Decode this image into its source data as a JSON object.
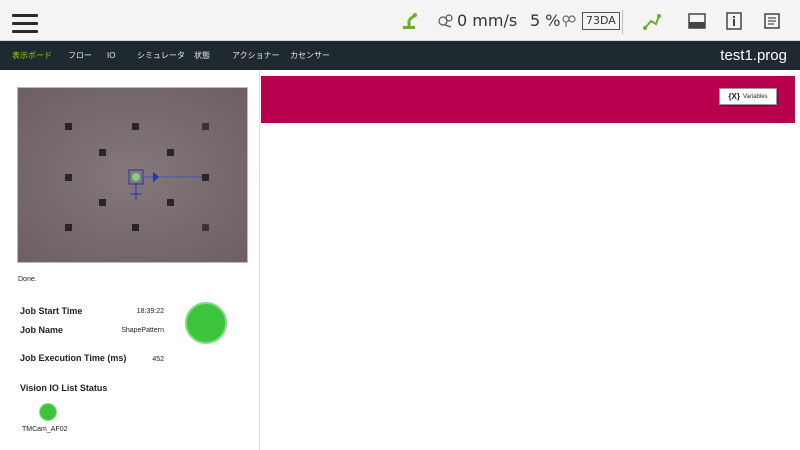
{
  "topbar": {
    "speed": "0 mm/s",
    "speed_percent": "5 %",
    "device_id": "73DA",
    "icons": [
      "menu-icon",
      "robot-arm-icon",
      "speed-icon",
      "key-icon",
      "controller-icon",
      "display-icon",
      "info-icon",
      "document-icon"
    ]
  },
  "nav": {
    "items": [
      "表示ボード",
      "フロー",
      "IO",
      "シミュレータ",
      "状態",
      "アクショナー",
      "カセンサー"
    ],
    "active_index": 0,
    "program_name": "test1.prog"
  },
  "vision": {
    "status": "Done.",
    "job_start_time_label": "Job Start Time",
    "job_start_time_value": "18:39:22",
    "job_name_label": "Job Name",
    "job_name_value": "ShapePattern",
    "job_exec_time_label": "Job Execution Time (ms)",
    "job_exec_time_value": "452",
    "io_status_label": "Vision IO List Status",
    "camera_name": "TMCam_AF02",
    "indicator_color": "#3cc43c"
  },
  "right": {
    "banner_color": "#b8004f",
    "variables_icon": "{X}",
    "variables_label": "Variables"
  },
  "colors": {
    "nav_bg": "#1f2a30",
    "nav_active": "#8fd400"
  }
}
